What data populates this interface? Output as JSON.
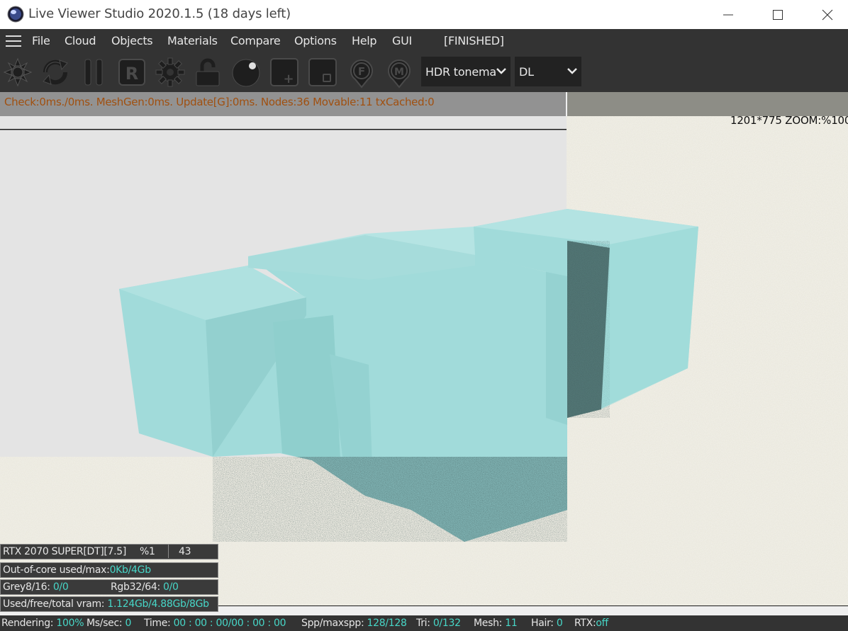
{
  "window": {
    "title": "Live Viewer Studio 2020.1.5 (18 days left)"
  },
  "menu": {
    "items": [
      "File",
      "Cloud",
      "Objects",
      "Materials",
      "Compare",
      "Options",
      "Help",
      "GUI"
    ],
    "status": "[FINISHED]"
  },
  "toolbar": {
    "icons": [
      "octane-logo-icon",
      "refresh-icon",
      "pause-icon",
      "r-icon",
      "gear-icon",
      "lock-open-icon",
      "sphere-icon",
      "add-region-icon",
      "region-icon",
      "focus-pin-icon",
      "material-pin-icon"
    ],
    "tonemap_label": "HDR tonema",
    "kernel_label": "DL"
  },
  "stats": {
    "text": "Check:0ms./0ms. MeshGen:0ms. Update[G]:0ms. Nodes:36 Movable:11 txCached:0"
  },
  "viewport": {
    "zoom_text": "1201*775 ZOOM:%100"
  },
  "info": {
    "gpu": "RTX 2070 SUPER[DT][7.5]",
    "gpu_pct": "%1",
    "gpu_temp": "43",
    "ooc_label": "Out-of-core used/max:",
    "ooc_value": "0Kb/4Gb",
    "grey_label": "Grey8/16:",
    "grey_value": "0/0",
    "rgb_label": "Rgb32/64:",
    "rgb_value": "0/0",
    "vram_label": "Used/free/total vram:",
    "vram_value": "1.124Gb/4.88Gb/8Gb"
  },
  "status": {
    "rendering_label": "Rendering:",
    "rendering_value": "100%",
    "mssec_label": "Ms/sec:",
    "mssec_value": "0",
    "time_label": "Time:",
    "time_value": "00 : 00 : 00/00 : 00 : 00",
    "spp_label": "Spp/maxspp:",
    "spp_value": "128/128",
    "tri_label": "Tri:",
    "tri_value": "0/132",
    "mesh_label": "Mesh:",
    "mesh_value": "11",
    "hair_label": "Hair:",
    "hair_value": "0",
    "rtx_label": "RTX:",
    "rtx_value": "off"
  },
  "colors": {
    "accent_teal": "#47d7c8",
    "stats_text": "#a05010",
    "object_cyan": "#9ed9d8",
    "background_grey": "#e3e3e3"
  }
}
